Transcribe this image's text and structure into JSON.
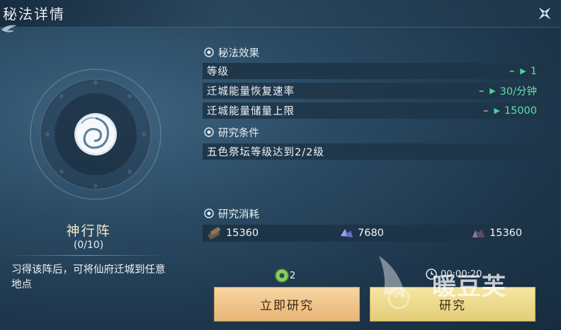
{
  "window": {
    "title": "秘法详情"
  },
  "skill": {
    "name": "神行阵",
    "level": "(0/10)",
    "description": "习得该阵后，可将仙府迁城到任意地点"
  },
  "effects": {
    "heading": "秘法效果",
    "rows": [
      {
        "label": "等级",
        "from": "–",
        "to": "1"
      },
      {
        "label": "迁城能量恢复速率",
        "from": "–",
        "to": "30/分钟"
      },
      {
        "label": "迁城能量储量上限",
        "from": "–",
        "to": "15000"
      }
    ]
  },
  "conditions": {
    "heading": "研究条件",
    "rows": [
      {
        "label": "五色祭坛等级达到2/2级"
      }
    ]
  },
  "costs": {
    "heading": "研究消耗",
    "items": [
      {
        "icon": "wood-resource-icon",
        "value": "15360"
      },
      {
        "icon": "crystal-resource-icon",
        "value": "7680"
      },
      {
        "icon": "ore-resource-icon",
        "value": "15360"
      }
    ]
  },
  "actions": {
    "instant_cost": "2",
    "instant_label": "立即研究",
    "timer": "00:00:20",
    "research_label": "研究"
  },
  "watermark": {
    "text": "暖豆芙"
  },
  "colors": {
    "accent_green": "#5fe0a8",
    "button_orange": "#f2c68c",
    "button_yellow": "#efdb8e"
  }
}
